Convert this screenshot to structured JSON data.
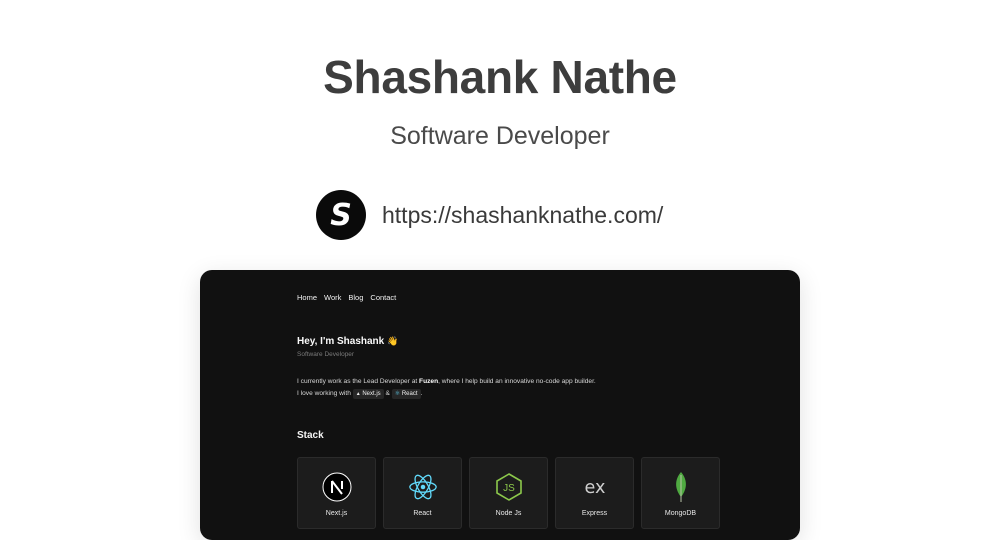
{
  "header": {
    "title": "Shashank Nathe",
    "subtitle": "Software Developer",
    "avatar_letter": "S",
    "url": "https://shashanknathe.com/"
  },
  "preview": {
    "nav": [
      "Home",
      "Work",
      "Blog",
      "Contact"
    ],
    "hero": {
      "greeting": "Hey, I'm Shashank",
      "wave_emoji": "👋",
      "role": "Software Developer"
    },
    "intro": {
      "line1_prefix": "I currently work as the Lead Developer at ",
      "company": "Fuzen",
      "line1_suffix": ", where I help build an innovative no-code app builder.",
      "line2_prefix": "I love working with ",
      "chip1": "Next.js",
      "amp": "&",
      "chip2": "React",
      "line2_suffix": "."
    },
    "stack_title": "Stack",
    "stack": [
      {
        "label": "Next.js",
        "icon": "nextjs-icon"
      },
      {
        "label": "React",
        "icon": "react-icon"
      },
      {
        "label": "Node Js",
        "icon": "nodejs-icon"
      },
      {
        "label": "Express",
        "icon": "express-icon"
      },
      {
        "label": "MongoDB",
        "icon": "mongodb-icon"
      }
    ]
  },
  "colors": {
    "background": "#ffffff",
    "title": "#3d3d3d",
    "preview_bg": "#111111",
    "card_bg": "#1c1c1c",
    "react_blue": "#61dafb",
    "node_green": "#8cc84b",
    "mongo_green": "#4faa41"
  }
}
